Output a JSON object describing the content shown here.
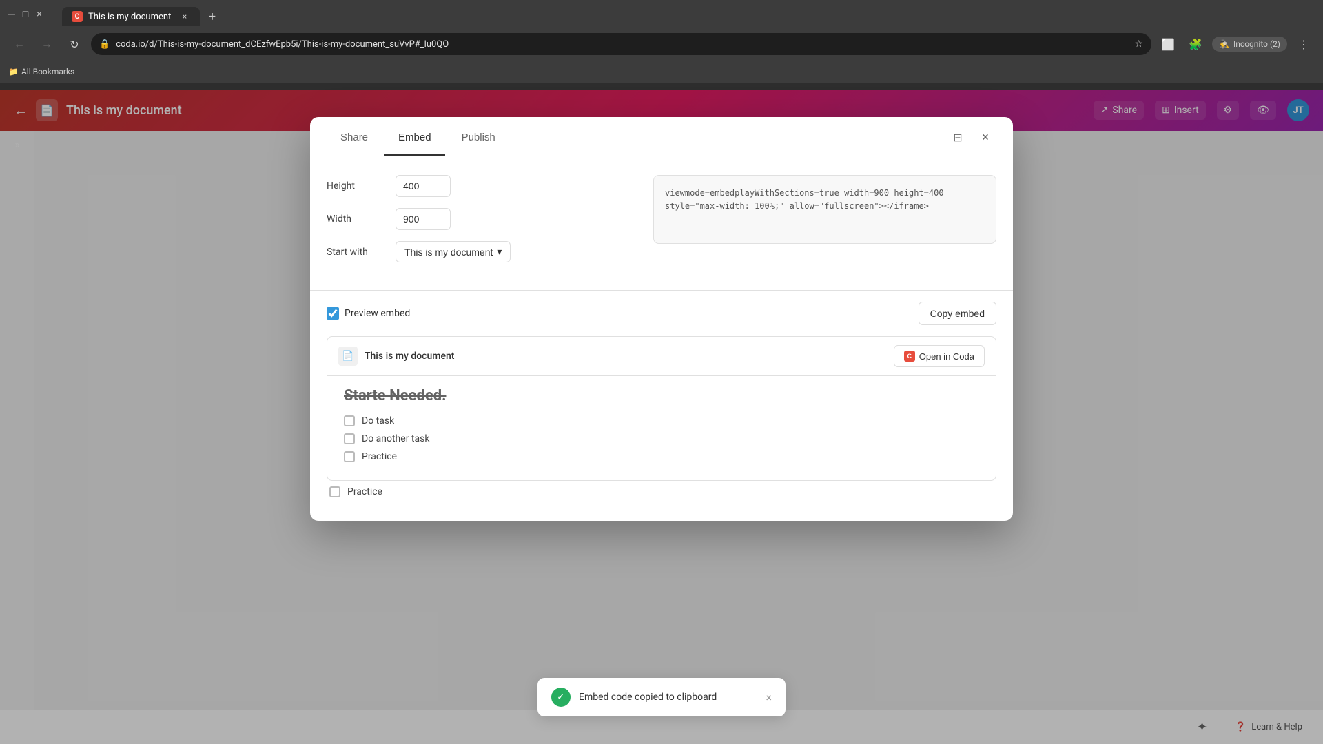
{
  "browser": {
    "tab_title": "This is my document",
    "tab_favicon": "C",
    "address": "coda.io/d/This-is-my-document_dCEzfwEpb5i/This-is-my-document_suVvP#_lu0QO",
    "incognito_label": "Incognito (2)",
    "bookmarks_label": "All Bookmarks",
    "new_tab_symbol": "+",
    "close_symbol": "×"
  },
  "app_header": {
    "doc_title": "This is my document",
    "share_label": "Share",
    "insert_label": "Insert",
    "avatar_initials": "JT"
  },
  "modal": {
    "tab_share": "Share",
    "tab_embed": "Embed",
    "tab_publish": "Publish",
    "active_tab": "Embed",
    "height_label": "Height",
    "height_value": "400",
    "width_label": "Width",
    "width_value": "900",
    "start_with_label": "Start with",
    "start_with_value": "This is my document",
    "code_content": "viewmode=embedplayWithSections=true  width=900\nheight=400 style=\"max-width: 100%;\"\nallow=\"fullscreen\"></iframe>",
    "preview_embed_label": "Preview embed",
    "copy_embed_label": "Copy embed",
    "embed_doc_title": "This is my document",
    "open_in_coda_label": "Open in Coda",
    "content_heading": "Starte Needed.",
    "tasks": [
      {
        "label": "Do task",
        "checked": false
      },
      {
        "label": "Do another task",
        "checked": false
      },
      {
        "label": "Practice",
        "checked": false
      },
      {
        "label": "Practice",
        "checked": false
      }
    ]
  },
  "toast": {
    "message": "Embed code copied to clipboard",
    "close_symbol": "×"
  },
  "bottom_bar": {
    "learn_help_label": "Learn & Help"
  }
}
